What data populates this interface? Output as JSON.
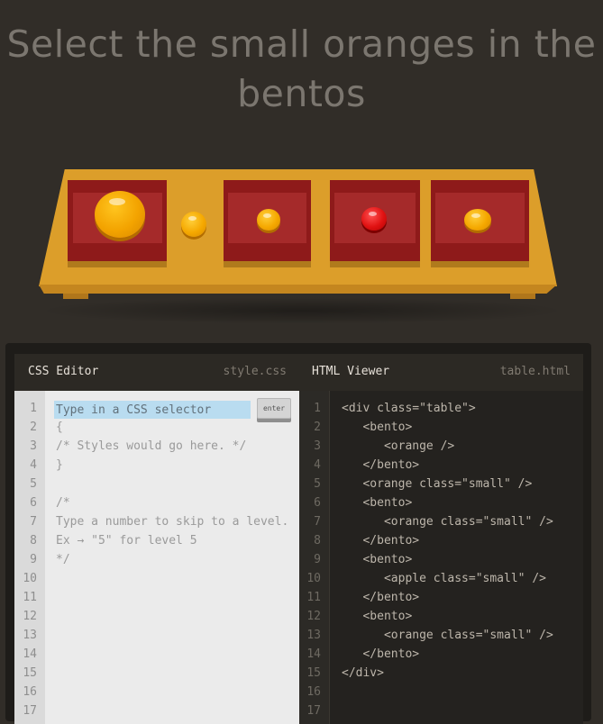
{
  "instruction": "Select the small oranges in the bentos",
  "css_editor": {
    "title": "CSS Editor",
    "filename": "style.css",
    "input_placeholder": "Type in a CSS selector",
    "enter_label": "enter",
    "lines": [
      "",
      "{",
      "/* Styles would go here. */",
      "}",
      "",
      "/*",
      "Type a number to skip to a level.",
      "Ex → \"5\" for level 5",
      "*/",
      "",
      "",
      "",
      "",
      "",
      "",
      "",
      ""
    ]
  },
  "html_viewer": {
    "title": "HTML Viewer",
    "filename": "table.html",
    "lines": [
      "<div class=\"table\">",
      "   <bento>",
      "      <orange />",
      "   </bento>",
      "   <orange class=\"small\" />",
      "   <bento>",
      "      <orange class=\"small\" />",
      "   </bento>",
      "   <bento>",
      "      <apple class=\"small\" />",
      "   </bento>",
      "   <bento>",
      "      <orange class=\"small\" />",
      "   </bento>",
      "</div>",
      "",
      ""
    ]
  },
  "line_numbers": [
    "1",
    "2",
    "3",
    "4",
    "5",
    "6",
    "7",
    "8",
    "9",
    "10",
    "11",
    "12",
    "13",
    "14",
    "15",
    "16",
    "17"
  ],
  "colors": {
    "background": "#312d28",
    "table": "#dc9e2a",
    "bento": "#8e1a1a",
    "orange": "#f5a800",
    "apple": "#e01212",
    "input_highlight": "#b9dcf0"
  }
}
